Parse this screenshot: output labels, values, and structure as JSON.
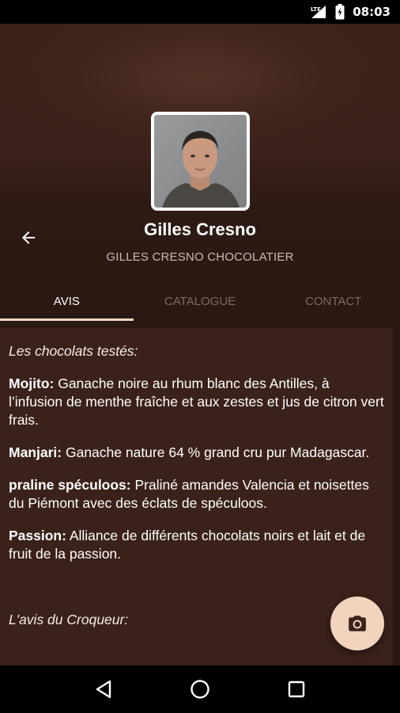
{
  "status_bar": {
    "time": "08:03",
    "icons": [
      "lte-signal-icon",
      "battery-icon"
    ]
  },
  "profile": {
    "name": "Gilles Cresno",
    "subtitle": "GILLES CRESNO CHOCOLATIER"
  },
  "tabs": [
    {
      "label": "AVIS",
      "active": true
    },
    {
      "label": "CATALOGUE",
      "active": false
    },
    {
      "label": "CONTACT",
      "active": false
    }
  ],
  "review": {
    "intro": "Les chocolats testés:",
    "items": [
      {
        "name": "Mojito:",
        "text": " Ganache noire au rhum blanc des Antilles, à l’infusion de menthe fraîche et aux zestes et jus de citron vert frais."
      },
      {
        "name": "Manjari:",
        "text": " Ganache nature 64 % grand cru pur Madagascar."
      },
      {
        "name": "praline spéculoos:",
        "text": " Praliné amandes Valencia et noisettes du Piémont avec des éclats de spéculoos."
      },
      {
        "name": "Passion:",
        "text": " Alliance de différents chocolats noirs et lait et de fruit de la passion."
      }
    ],
    "opinion_heading": "L'avis du Croqueur:"
  },
  "fab": {
    "icon": "camera-icon"
  },
  "nav_bar": {
    "icons": [
      "back-triangle-icon",
      "home-circle-icon",
      "recents-square-icon"
    ]
  },
  "colors": {
    "background": "#3a2119",
    "accent": "#f2d3bd",
    "inactive_tab": "#7f6a5f"
  }
}
